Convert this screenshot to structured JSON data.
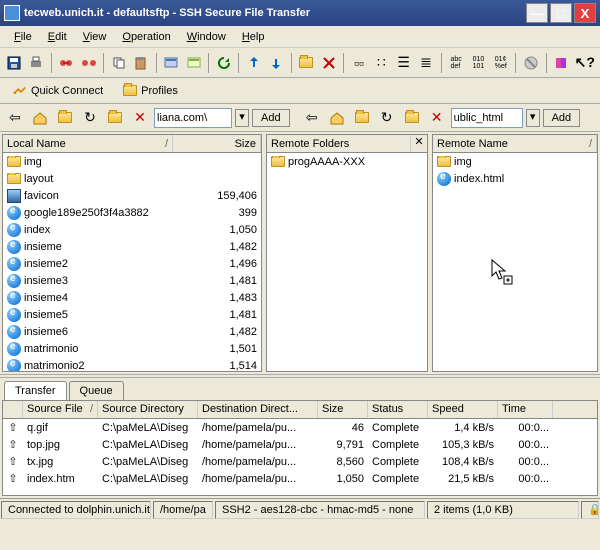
{
  "title": "tecweb.unich.it - defaultsftp - SSH Secure File Transfer",
  "menu": [
    "File",
    "Edit",
    "View",
    "Operation",
    "Window",
    "Help"
  ],
  "quickbar": {
    "quick_connect": "Quick Connect",
    "profiles": "Profiles"
  },
  "nav": {
    "local_path": "liana.com\\",
    "remote_path": "ublic_html",
    "add_label": "Add"
  },
  "local": {
    "header_name": "Local Name",
    "header_size": "Size",
    "items": [
      {
        "icon": "folder",
        "name": "img",
        "size": ""
      },
      {
        "icon": "folder",
        "name": "layout",
        "size": ""
      },
      {
        "icon": "fav",
        "name": "favicon",
        "size": "159,406"
      },
      {
        "icon": "ie",
        "name": "google189e250f3f4a3882",
        "size": "399"
      },
      {
        "icon": "ie",
        "name": "index",
        "size": "1,050"
      },
      {
        "icon": "ie",
        "name": "insieme",
        "size": "1,482"
      },
      {
        "icon": "ie",
        "name": "insieme2",
        "size": "1,496"
      },
      {
        "icon": "ie",
        "name": "insieme3",
        "size": "1,481"
      },
      {
        "icon": "ie",
        "name": "insieme4",
        "size": "1,483"
      },
      {
        "icon": "ie",
        "name": "insieme5",
        "size": "1,481"
      },
      {
        "icon": "ie",
        "name": "insieme6",
        "size": "1,482"
      },
      {
        "icon": "ie",
        "name": "matrimonio",
        "size": "1,501"
      },
      {
        "icon": "ie",
        "name": "matrimonio2",
        "size": "1,514"
      }
    ]
  },
  "remote_folders": {
    "header": "Remote Folders",
    "items": [
      {
        "icon": "folder",
        "name": "progAAAA-XXX"
      }
    ]
  },
  "remote": {
    "header_name": "Remote Name",
    "items": [
      {
        "icon": "folder",
        "name": "img"
      },
      {
        "icon": "ie",
        "name": "index.html"
      }
    ]
  },
  "transfer": {
    "tabs": [
      "Transfer",
      "Queue"
    ],
    "cols": [
      "",
      "Source File",
      "Source Directory",
      "Destination Direct...",
      "Size",
      "Status",
      "Speed",
      "Time"
    ],
    "rows": [
      {
        "dir": "up",
        "src": "q.gif",
        "sdir": "C:\\paMeLA\\Diseg",
        "ddir": "/home/pamela/pu...",
        "size": "46",
        "status": "Complete",
        "speed": "1,4 kB/s",
        "time": "00:0..."
      },
      {
        "dir": "up",
        "src": "top.jpg",
        "sdir": "C:\\paMeLA\\Diseg",
        "ddir": "/home/pamela/pu...",
        "size": "9,791",
        "status": "Complete",
        "speed": "105,3 kB/s",
        "time": "00:0..."
      },
      {
        "dir": "up",
        "src": "tx.jpg",
        "sdir": "C:\\paMeLA\\Diseg",
        "ddir": "/home/pamela/pu...",
        "size": "8,560",
        "status": "Complete",
        "speed": "108,4 kB/s",
        "time": "00:0..."
      },
      {
        "dir": "up",
        "src": "index.htm",
        "sdir": "C:\\paMeLA\\Diseg",
        "ddir": "/home/pamela/pu...",
        "size": "1,050",
        "status": "Complete",
        "speed": "21,5 kB/s",
        "time": "00:0..."
      }
    ]
  },
  "status": {
    "conn": "Connected to dolphin.unich.it -",
    "path": "/home/pa",
    "enc": "SSH2 - aes128-cbc - hmac-md5 - none",
    "items": "2 items (1,0 KB)"
  }
}
